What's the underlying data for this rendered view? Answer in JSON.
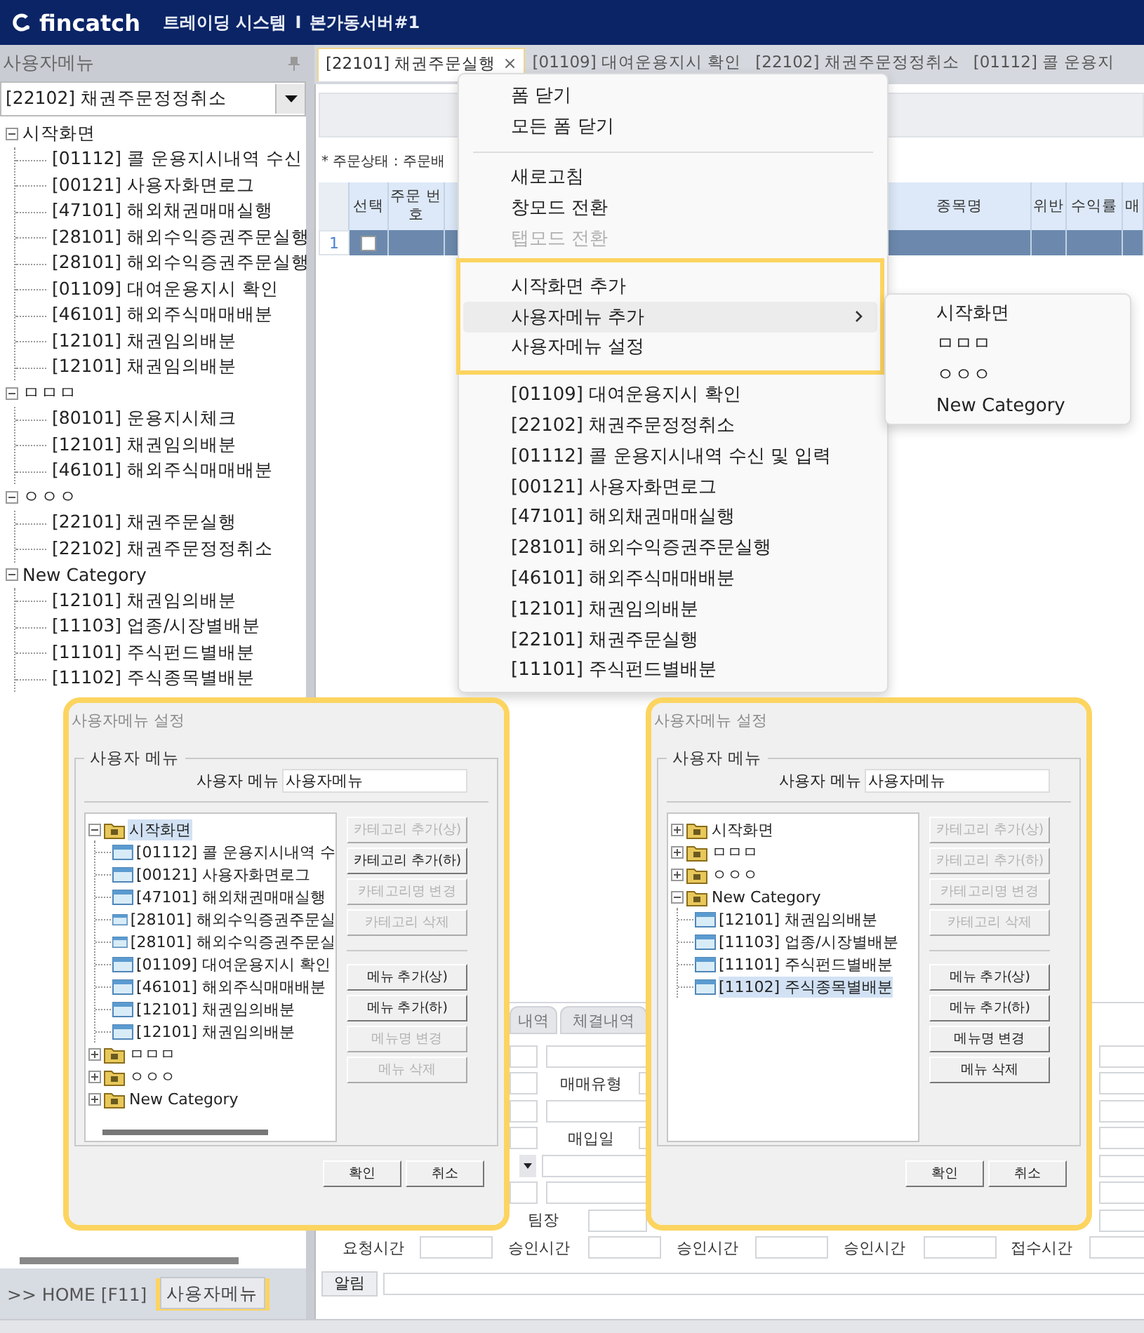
{
  "header": {
    "brand": "fincatch",
    "title": "트레이딩 시스템",
    "divider": "I",
    "server": "본가동서버#1"
  },
  "sidebar": {
    "title": "사용자메뉴",
    "selector": {
      "value": "[22102] 채권주문정정취소"
    },
    "tree": [
      {
        "label": "시작화면",
        "expanded": true,
        "children": [
          {
            "label": "[01112] 콜 운용지시내역 수신"
          },
          {
            "label": "[00121] 사용자화면로그"
          },
          {
            "label": "[47101] 해외채권매매실행"
          },
          {
            "label": "[28101] 해외수익증권주문실행"
          },
          {
            "label": "[28101] 해외수익증권주문실행"
          },
          {
            "label": "[01109] 대여운용지시 확인"
          },
          {
            "label": "[46101] 해외주식매매배분"
          },
          {
            "label": "[12101] 채권임의배분"
          },
          {
            "label": "[12101] 채권임의배분"
          }
        ]
      },
      {
        "label": "ㅁㅁㅁ",
        "expanded": true,
        "children": [
          {
            "label": "[80101] 운용지시체크"
          },
          {
            "label": "[12101] 채권임의배분"
          },
          {
            "label": "[46101] 해외주식매매배분"
          }
        ]
      },
      {
        "label": "ㅇㅇㅇ",
        "expanded": true,
        "children": [
          {
            "label": "[22101] 채권주문실행"
          },
          {
            "label": "[22102] 채권주문정정취소"
          }
        ]
      },
      {
        "label": "New Category",
        "expanded": true,
        "children": [
          {
            "label": "[12101] 채권임의배분"
          },
          {
            "label": "[11103] 업종/시장별배분"
          },
          {
            "label": "[11101] 주식펀드별배분"
          },
          {
            "label": "[11102] 주식종목별배분"
          }
        ]
      }
    ],
    "footer": {
      "home": ">> HOME [F11]",
      "button": {
        "label": "사용자메뉴",
        "highlighted": true
      }
    }
  },
  "tabs": [
    {
      "label": "[22101] 채권주문실행",
      "close": "×",
      "selected": true
    },
    {
      "label": "[01109] 대여운용지시 확인",
      "selected": false
    },
    {
      "label": "[22102] 채권주문정정취소",
      "selected": false
    },
    {
      "label": "[01112] 콜 운용지",
      "selected": false
    }
  ],
  "main": {
    "note": "* 주문상태 : 주문배",
    "grid": {
      "columns": [
        "선택",
        "주문 번호",
        "종목명",
        "위반",
        "수익률",
        "매"
      ],
      "rows": [
        {
          "index": "1",
          "checked": false,
          "selected": true
        }
      ]
    }
  },
  "order_panel": {
    "tabs": [
      "내역",
      "체결내역"
    ],
    "labels": [
      "매매유형",
      "매입일",
      "팀장"
    ],
    "time_labels": [
      "요청시간",
      "승인시간",
      "승인시간",
      "승인시간",
      "접수시간"
    ],
    "alert": "알림"
  },
  "context_menu": {
    "groups": [
      {
        "highlighted": false,
        "items": [
          {
            "label": "폼 닫기",
            "disabled": false,
            "hovered": false
          },
          {
            "label": "모든 폼 닫기",
            "disabled": false,
            "hovered": false
          }
        ]
      },
      {
        "highlighted": false,
        "items": [
          {
            "label": "새로고침",
            "disabled": false,
            "hovered": false
          },
          {
            "label": "창모드 전환",
            "disabled": false,
            "hovered": false
          },
          {
            "label": "탭모드 전환",
            "disabled": true,
            "hovered": false
          }
        ]
      },
      {
        "highlighted": true,
        "items": [
          {
            "label": "시작화면 추가",
            "disabled": false,
            "hovered": false
          },
          {
            "label": "사용자메뉴 추가",
            "disabled": false,
            "hovered": true,
            "kind": "submenu"
          },
          {
            "label": "사용자메뉴 설정",
            "disabled": false,
            "hovered": false
          }
        ]
      },
      {
        "highlighted": false,
        "items": [
          {
            "label": "[01109] 대여운용지시 확인",
            "disabled": false,
            "hovered": false
          },
          {
            "label": "[22102] 채권주문정정취소",
            "disabled": false,
            "hovered": false
          },
          {
            "label": "[01112] 콜 운용지시내역 수신 및 입력",
            "disabled": false,
            "hovered": false
          },
          {
            "label": "[00121] 사용자화면로그",
            "disabled": false,
            "hovered": false
          },
          {
            "label": "[47101] 해외채권매매실행",
            "disabled": false,
            "hovered": false
          },
          {
            "label": "[28101] 해외수익증권주문실행",
            "disabled": false,
            "hovered": false
          },
          {
            "label": "[46101] 해외주식매매배분",
            "disabled": false,
            "hovered": false
          },
          {
            "label": "[12101] 채권임의배분",
            "disabled": false,
            "hovered": false
          },
          {
            "label": "[22101] 채권주문실행",
            "disabled": false,
            "hovered": false
          },
          {
            "label": "[11101] 주식펀드별배분",
            "disabled": false,
            "hovered": false
          }
        ]
      }
    ],
    "submenu": [
      "시작화면",
      "ㅁㅁㅁ",
      "ㅇㅇㅇ",
      "New Category"
    ]
  },
  "dialogs": [
    {
      "title": "사용자메뉴 설정",
      "highlighted": true,
      "group": "사용자 메뉴",
      "name_label": "사용자 메뉴",
      "name_value": "사용자메뉴",
      "tree": [
        {
          "label": "시작화면",
          "expanded": true,
          "selected": true,
          "children": [
            {
              "label": "[01112] 콜 운용지시내역 수",
              "selected": false
            },
            {
              "label": "[00121] 사용자화면로그",
              "selected": false
            },
            {
              "label": "[47101] 해외채권매매실행",
              "selected": false
            },
            {
              "label": "[28101] 해외수익증권주문실",
              "selected": false
            },
            {
              "label": "[28101] 해외수익증권주문실",
              "selected": false
            },
            {
              "label": "[01109] 대여운용지시 확인",
              "selected": false
            },
            {
              "label": "[46101] 해외주식매매배분",
              "selected": false
            },
            {
              "label": "[12101] 채권임의배분",
              "selected": false
            },
            {
              "label": "[12101] 채권임의배분",
              "selected": false
            }
          ]
        },
        {
          "label": "ㅁㅁㅁ",
          "expanded": false,
          "selected": false
        },
        {
          "label": "ㅇㅇㅇ",
          "expanded": false,
          "selected": false
        },
        {
          "label": "New Category",
          "expanded": false,
          "selected": false
        }
      ],
      "category_buttons": [
        {
          "label": "카테고리 추가(상)",
          "disabled": true
        },
        {
          "label": "카테고리 추가(하)",
          "disabled": false
        },
        {
          "label": "카테고리명 변경",
          "disabled": true
        },
        {
          "label": "카테고리 삭제",
          "disabled": true
        }
      ],
      "menu_buttons": [
        {
          "label": "메뉴 추가(상)",
          "disabled": false
        },
        {
          "label": "메뉴 추가(하)",
          "disabled": false
        },
        {
          "label": "메뉴명 변경",
          "disabled": true
        },
        {
          "label": "메뉴 삭제",
          "disabled": true
        }
      ],
      "ok": "확인",
      "cancel": "취소"
    },
    {
      "title": "사용자메뉴 설정",
      "highlighted": true,
      "group": "사용자 메뉴",
      "name_label": "사용자 메뉴",
      "name_value": "사용자메뉴",
      "tree": [
        {
          "label": "시작화면",
          "expanded": false,
          "selected": false
        },
        {
          "label": "ㅁㅁㅁ",
          "expanded": false,
          "selected": false
        },
        {
          "label": "ㅇㅇㅇ",
          "expanded": false,
          "selected": false
        },
        {
          "label": "New Category",
          "expanded": true,
          "selected": false,
          "children": [
            {
              "label": "[12101] 채권임의배분",
              "selected": false
            },
            {
              "label": "[11103] 업종/시장별배분",
              "selected": false
            },
            {
              "label": "[11101] 주식펀드별배분",
              "selected": false
            },
            {
              "label": "[11102] 주식종목별배분",
              "selected": true
            }
          ]
        }
      ],
      "category_buttons": [
        {
          "label": "카테고리 추가(상)",
          "disabled": true
        },
        {
          "label": "카테고리 추가(하)",
          "disabled": true
        },
        {
          "label": "카테고리명 변경",
          "disabled": true
        },
        {
          "label": "카테고리 삭제",
          "disabled": true
        }
      ],
      "menu_buttons": [
        {
          "label": "메뉴 추가(상)",
          "disabled": false
        },
        {
          "label": "메뉴 추가(하)",
          "disabled": false
        },
        {
          "label": "메뉴명 변경",
          "disabled": false
        },
        {
          "label": "메뉴 삭제",
          "disabled": false
        }
      ],
      "ok": "확인",
      "cancel": "취소"
    }
  ]
}
